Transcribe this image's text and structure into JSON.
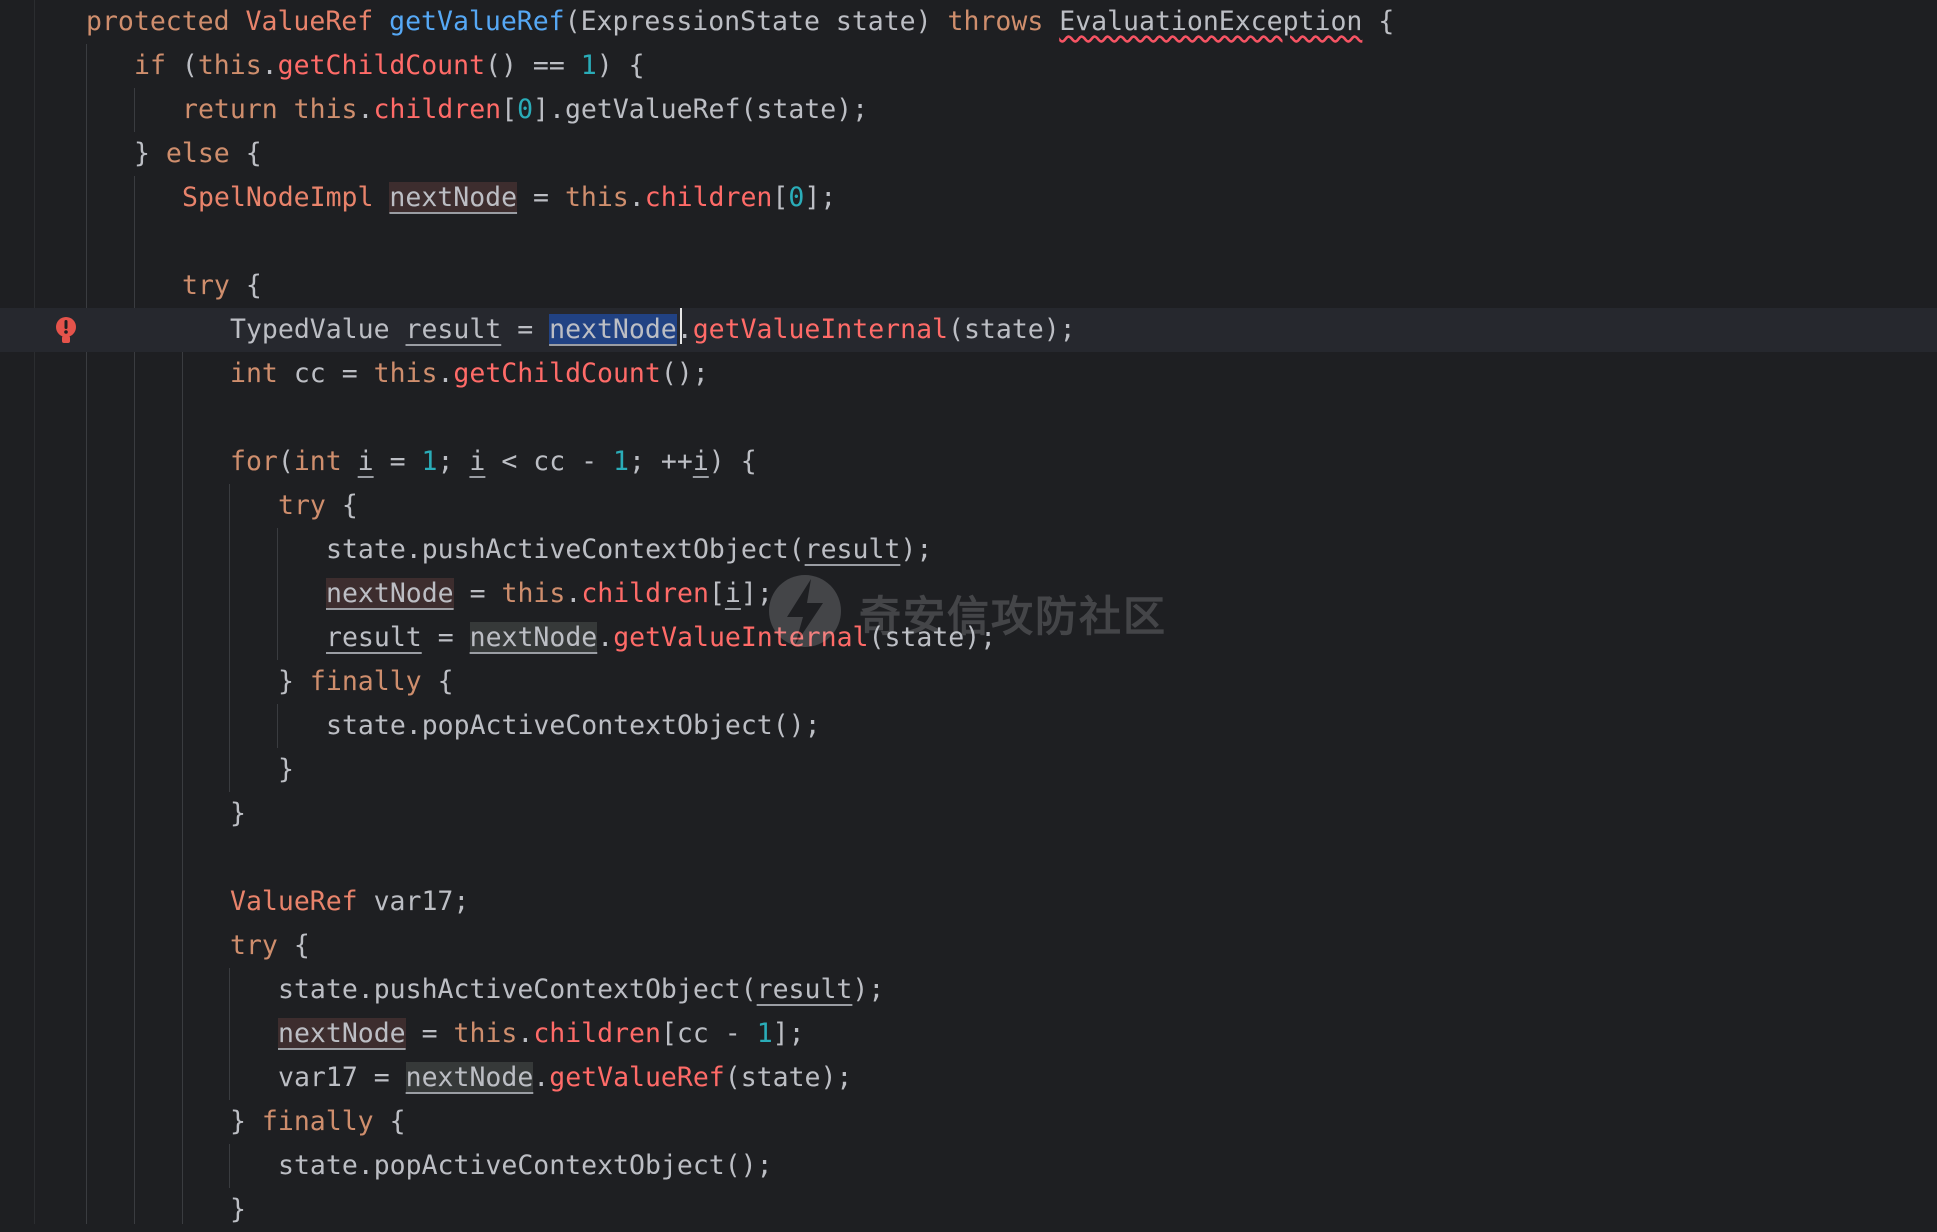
{
  "editor": {
    "lines": [
      {
        "tokens": [
          [
            "kw",
            "protected "
          ],
          [
            "type",
            "ValueRef "
          ],
          [
            "fn",
            "getValueRef"
          ],
          [
            "plain",
            "(ExpressionState state) "
          ],
          [
            "kw",
            "throws "
          ],
          [
            "err",
            "EvaluationException"
          ],
          [
            "plain",
            " {"
          ]
        ]
      },
      {
        "tokens": [
          [
            "kw",
            "if "
          ],
          [
            "plain",
            "("
          ],
          [
            "kw",
            "this"
          ],
          [
            "plain",
            "."
          ],
          [
            "call",
            "getChildCount"
          ],
          [
            "plain",
            "() == "
          ],
          [
            "num",
            "1"
          ],
          [
            "plain",
            ") {"
          ]
        ]
      },
      {
        "tokens": [
          [
            "kw",
            "return this"
          ],
          [
            "plain",
            "."
          ],
          [
            "field",
            "children"
          ],
          [
            "plain",
            "["
          ],
          [
            "num",
            "0"
          ],
          [
            "plain",
            "].getValueRef(state);"
          ]
        ]
      },
      {
        "tokens": [
          [
            "plain",
            "} "
          ],
          [
            "kw",
            "else"
          ],
          [
            "plain",
            " {"
          ]
        ]
      },
      {
        "tokens": [
          [
            "type",
            "SpelNodeImpl "
          ],
          [
            "varhl",
            "nextNode"
          ],
          [
            "plain",
            " = "
          ],
          [
            "kw",
            "this"
          ],
          [
            "plain",
            "."
          ],
          [
            "field",
            "children"
          ],
          [
            "plain",
            "["
          ],
          [
            "num",
            "0"
          ],
          [
            "plain",
            "];"
          ]
        ]
      },
      {
        "tokens": []
      },
      {
        "tokens": [
          [
            "kw",
            "try"
          ],
          [
            "plain",
            " {"
          ]
        ]
      },
      {
        "tokens": [
          [
            "plain",
            "TypedValue "
          ],
          [
            "var",
            "result"
          ],
          [
            "plain",
            " = "
          ],
          [
            "sel",
            "nextNode"
          ],
          [
            "plain",
            "."
          ],
          [
            "call",
            "getValueInternal"
          ],
          [
            "plain",
            "(state);"
          ]
        ]
      },
      {
        "tokens": [
          [
            "kw",
            "int "
          ],
          [
            "plain",
            "cc = "
          ],
          [
            "kw",
            "this"
          ],
          [
            "plain",
            "."
          ],
          [
            "call",
            "getChildCount"
          ],
          [
            "plain",
            "();"
          ]
        ]
      },
      {
        "tokens": []
      },
      {
        "tokens": [
          [
            "kw",
            "for"
          ],
          [
            "plain",
            "("
          ],
          [
            "kw",
            "int "
          ],
          [
            "var",
            "i"
          ],
          [
            "plain",
            " = "
          ],
          [
            "num",
            "1"
          ],
          [
            "plain",
            "; "
          ],
          [
            "var",
            "i"
          ],
          [
            "plain",
            " < cc - "
          ],
          [
            "num",
            "1"
          ],
          [
            "plain",
            "; ++"
          ],
          [
            "var",
            "i"
          ],
          [
            "plain",
            ") {"
          ]
        ]
      },
      {
        "tokens": [
          [
            "kw",
            "try"
          ],
          [
            "plain",
            " {"
          ]
        ]
      },
      {
        "tokens": [
          [
            "plain",
            "state.pushActiveContextObject("
          ],
          [
            "var",
            "result"
          ],
          [
            "plain",
            ");"
          ]
        ]
      },
      {
        "tokens": [
          [
            "varhl",
            "nextNode"
          ],
          [
            "plain",
            " = "
          ],
          [
            "kw",
            "this"
          ],
          [
            "plain",
            "."
          ],
          [
            "field",
            "children"
          ],
          [
            "plain",
            "["
          ],
          [
            "var",
            "i"
          ],
          [
            "plain",
            "];"
          ]
        ]
      },
      {
        "tokens": [
          [
            "var",
            "result"
          ],
          [
            "plain",
            " = "
          ],
          [
            "varhl2",
            "nextNode"
          ],
          [
            "plain",
            "."
          ],
          [
            "call",
            "getValueInternal"
          ],
          [
            "plain",
            "(state);"
          ]
        ]
      },
      {
        "tokens": [
          [
            "plain",
            "} "
          ],
          [
            "kw",
            "finally"
          ],
          [
            "plain",
            " {"
          ]
        ]
      },
      {
        "tokens": [
          [
            "plain",
            "state.popActiveContextObject();"
          ]
        ]
      },
      {
        "tokens": [
          [
            "plain",
            "}"
          ]
        ]
      },
      {
        "tokens": [
          [
            "plain",
            "}"
          ]
        ]
      },
      {
        "tokens": []
      },
      {
        "tokens": [
          [
            "type",
            "ValueRef "
          ],
          [
            "plain",
            "var17;"
          ]
        ]
      },
      {
        "tokens": [
          [
            "kw",
            "try"
          ],
          [
            "plain",
            " {"
          ]
        ]
      },
      {
        "tokens": [
          [
            "plain",
            "state.pushActiveContextObject("
          ],
          [
            "var",
            "result"
          ],
          [
            "plain",
            ");"
          ]
        ]
      },
      {
        "tokens": [
          [
            "varhl",
            "nextNode"
          ],
          [
            "plain",
            " = "
          ],
          [
            "kw",
            "this"
          ],
          [
            "plain",
            "."
          ],
          [
            "field",
            "children"
          ],
          [
            "plain",
            "[cc - "
          ],
          [
            "num",
            "1"
          ],
          [
            "plain",
            "];"
          ]
        ]
      },
      {
        "tokens": [
          [
            "plain",
            "var17 = "
          ],
          [
            "varhl2",
            "nextNode"
          ],
          [
            "plain",
            "."
          ],
          [
            "call",
            "getValueRef"
          ],
          [
            "plain",
            "(state);"
          ]
        ]
      },
      {
        "tokens": [
          [
            "plain",
            "} "
          ],
          [
            "kw",
            "finally"
          ],
          [
            "plain",
            " {"
          ]
        ]
      },
      {
        "tokens": [
          [
            "plain",
            "state.popActiveContextObject();"
          ]
        ]
      },
      {
        "tokens": [
          [
            "plain",
            "}"
          ]
        ]
      }
    ]
  },
  "watermark": {
    "text": "奇安信攻防社区"
  },
  "icons": {
    "gutter_marker": "error-bulb-icon",
    "watermark_logo": "lightning-logo-icon"
  },
  "colors": {
    "background": "#1e1f22",
    "keyword": "#cf8e6d",
    "type": "#e8836b",
    "method_decl": "#56a8f5",
    "method_call": "#ff6b68",
    "number": "#2aacb8",
    "plain": "#bcbec4",
    "selection": "#214283"
  }
}
